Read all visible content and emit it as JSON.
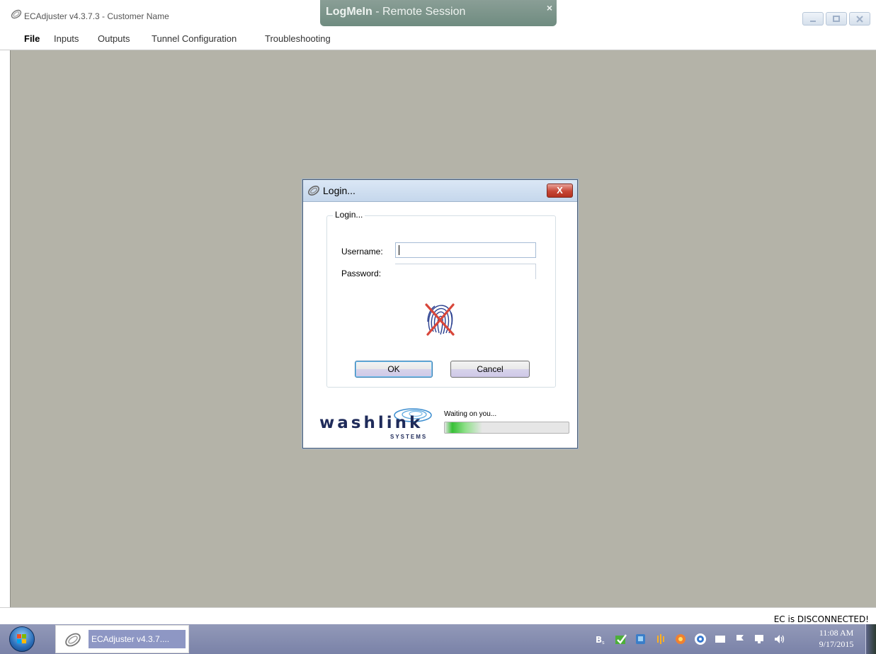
{
  "window": {
    "title": "ECAdjuster v4.3.7.3 - Customer Name",
    "buttons": [
      "minimize-icon",
      "maximize-icon",
      "close-icon"
    ]
  },
  "remote_banner": {
    "brand": "LogMeIn",
    "separator": " - ",
    "label": "Remote Session",
    "close": "×"
  },
  "menu": {
    "items": [
      {
        "label": "File",
        "active": true
      },
      {
        "label": "Inputs"
      },
      {
        "label": "Outputs"
      },
      {
        "label": "Tunnel Configuration"
      },
      {
        "label": "Troubleshooting"
      }
    ]
  },
  "dialog": {
    "title": "Login...",
    "close": "X",
    "group_label": "Login...",
    "username_label": "Username:",
    "username_value": "",
    "password_label": "Password:",
    "password_value": "",
    "fingerprint_icon": "fingerprint-disabled-icon",
    "ok_label": "OK",
    "cancel_label": "Cancel",
    "brand_word": "washlink",
    "brand_sub": "SYSTEMS",
    "status": "Waiting on you...",
    "progress_fraction": 0.3
  },
  "status_bar": {
    "message": "EC is DISCONNECTED!"
  },
  "taskbar": {
    "start_icon": "windows-start-icon",
    "task_label": "ECAdjuster v4.3.7....",
    "tray_icons": [
      "bluetooth-icon",
      "green-check-icon",
      "network-icon",
      "audio-icon",
      "shield-icon",
      "browser-icon",
      "battery-icon",
      "flag-icon",
      "monitor-icon",
      "volume-icon"
    ],
    "time": "11:08 AM",
    "date": "9/17/2015"
  },
  "colors": {
    "workspace": "#b4b3a8",
    "taskbar": "#8c93b4",
    "logmein_banner": "#7b948a",
    "dialog_close": "#c74635"
  }
}
